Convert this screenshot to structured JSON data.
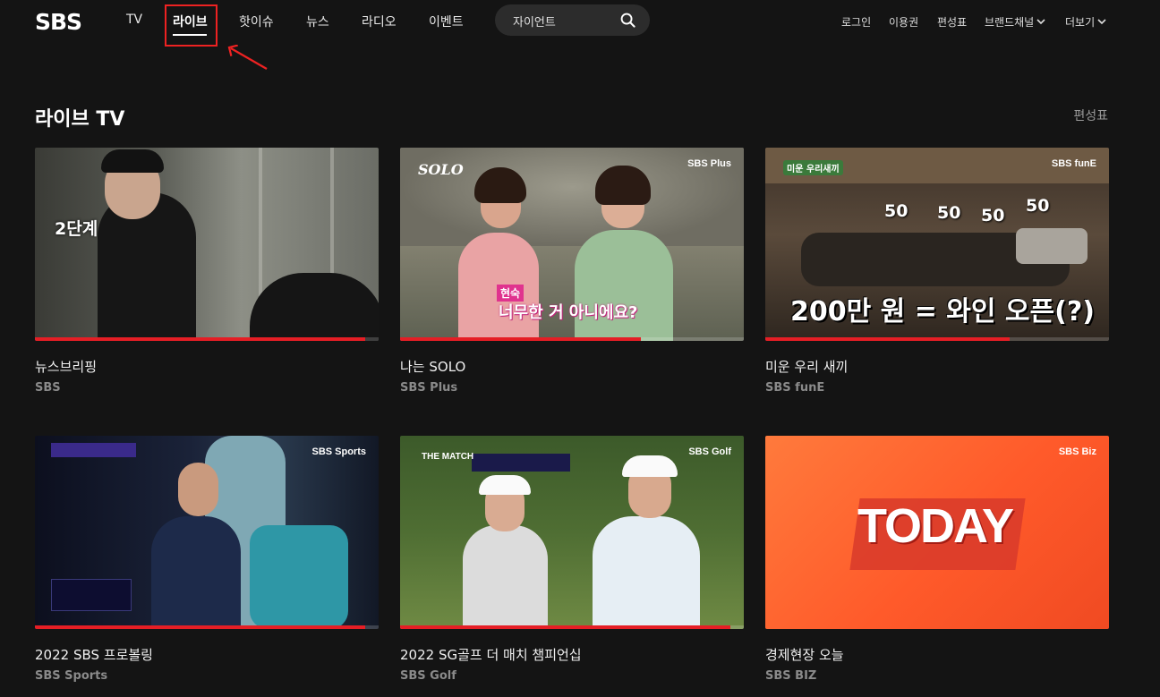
{
  "header": {
    "logo": "SBS",
    "nav": [
      "TV",
      "라이브",
      "핫이슈",
      "뉴스",
      "라디오",
      "이벤트"
    ],
    "search_value": "자이언트",
    "util": [
      "로그인",
      "이용권",
      "편성표",
      "브랜드채널",
      "더보기"
    ]
  },
  "section": {
    "title": "라이브 TV",
    "link": "편성표"
  },
  "cards": [
    {
      "title": "뉴스브리핑",
      "channel": "SBS",
      "progress": 0.96,
      "overlay": "2단계",
      "badge": ""
    },
    {
      "title": "나는 SOLO",
      "channel": "SBS Plus",
      "progress": 0.7,
      "overlay": "너무한 거 아니에요?",
      "tag": "현숙",
      "show_logo": "SOLO",
      "badge": "SBS Plus"
    },
    {
      "title": "미운 우리 새끼",
      "channel": "SBS funE",
      "progress": 0.71,
      "overlay": "200만 원 = 와인 오픈(?)",
      "nums": [
        "50",
        "50",
        "50",
        "50"
      ],
      "badge": "SBS funE"
    },
    {
      "title": "2022 SBS 프로볼링",
      "channel": "SBS Sports",
      "progress": 0.96,
      "badge": "SBS Sports"
    },
    {
      "title": "2022 SG골프 더 매치 챔피언십",
      "channel": "SBS Golf",
      "progress": 0.96,
      "badge": "SBS Golf",
      "show_logo": "THE MATCH"
    },
    {
      "title": "경제현장 오늘",
      "channel": "SBS BIZ",
      "progress": 0,
      "overlay": "TODAY",
      "badge": "SBS Biz"
    }
  ],
  "colors": {
    "accent": "#e51e25",
    "background": "#141414",
    "highlight": "#ee2222"
  }
}
